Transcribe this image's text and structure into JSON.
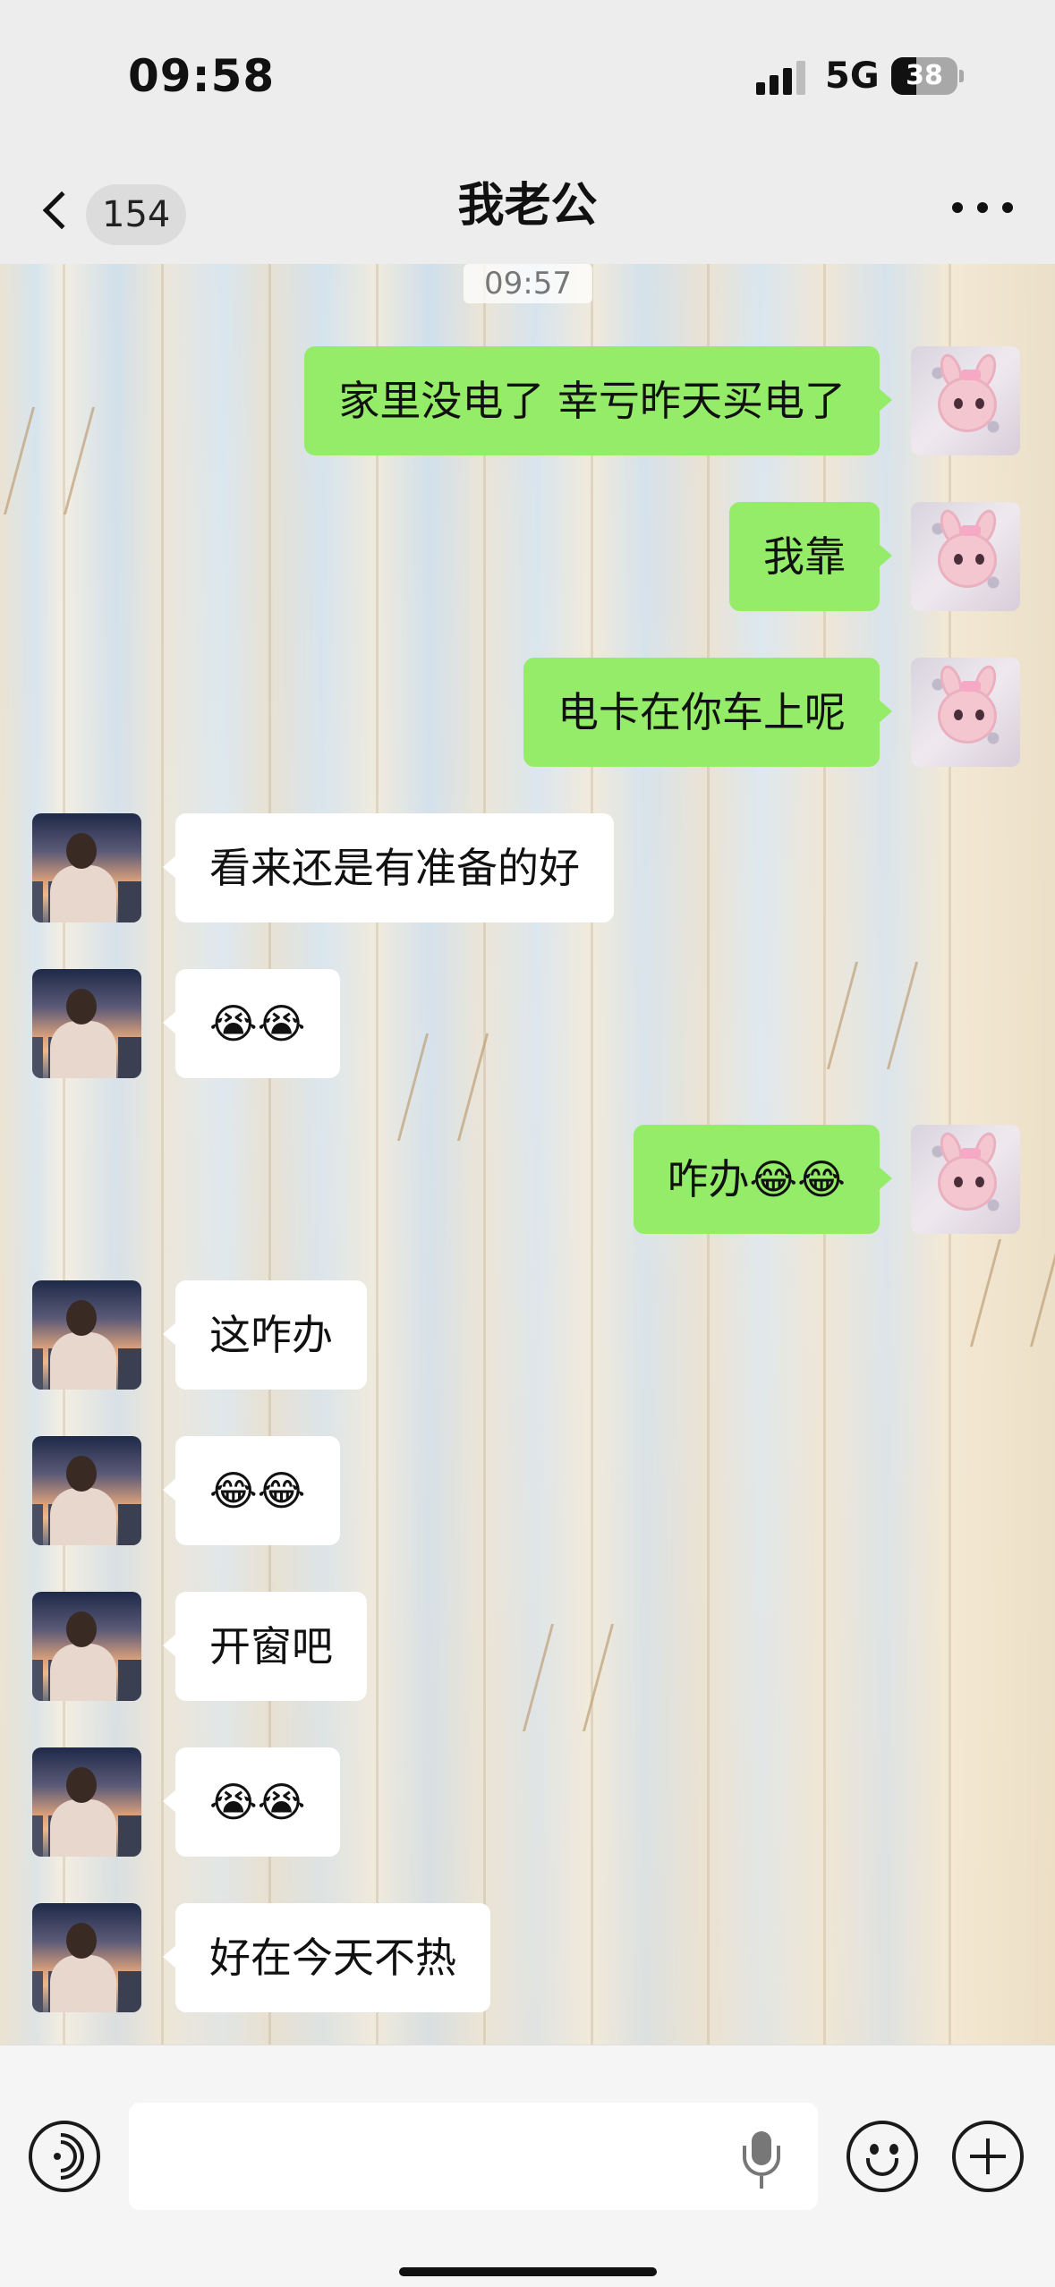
{
  "status_bar": {
    "time": "09:58",
    "network": "5G",
    "battery": "38",
    "signal_bars": 3,
    "battery_level": 0.38,
    "icons": [
      "signal-icon",
      "battery-icon"
    ]
  },
  "nav": {
    "back_icon": "chevron-left-icon",
    "unread_count": "154",
    "title": "我老公",
    "more_icon": "ellipsis-icon"
  },
  "chat": {
    "timestamp": "09:57",
    "messages": [
      {
        "side": "sent",
        "text": "家里没电了 幸亏昨天买电了"
      },
      {
        "side": "sent",
        "text": "我靠"
      },
      {
        "side": "sent",
        "text": "电卡在你车上呢"
      },
      {
        "side": "received",
        "text": "看来还是有准备的好"
      },
      {
        "side": "received",
        "text": "😭😭"
      },
      {
        "side": "sent",
        "text": "咋办😂😂"
      },
      {
        "side": "received",
        "text": "这咋办"
      },
      {
        "side": "received",
        "text": "😂😂"
      },
      {
        "side": "received",
        "text": "开窗吧"
      },
      {
        "side": "received",
        "text": "😭😭"
      },
      {
        "side": "received",
        "text": "好在今天不热"
      }
    ]
  },
  "input_bar": {
    "voice_icon": "voice-icon",
    "input_value": "",
    "mic_icon": "microphone-icon",
    "emoji_icon": "emoji-icon",
    "plus_icon": "plus-icon"
  },
  "colors": {
    "sent_bubble": "#95ec69",
    "received_bubble": "#ffffff",
    "bar_background": "#ededed"
  }
}
